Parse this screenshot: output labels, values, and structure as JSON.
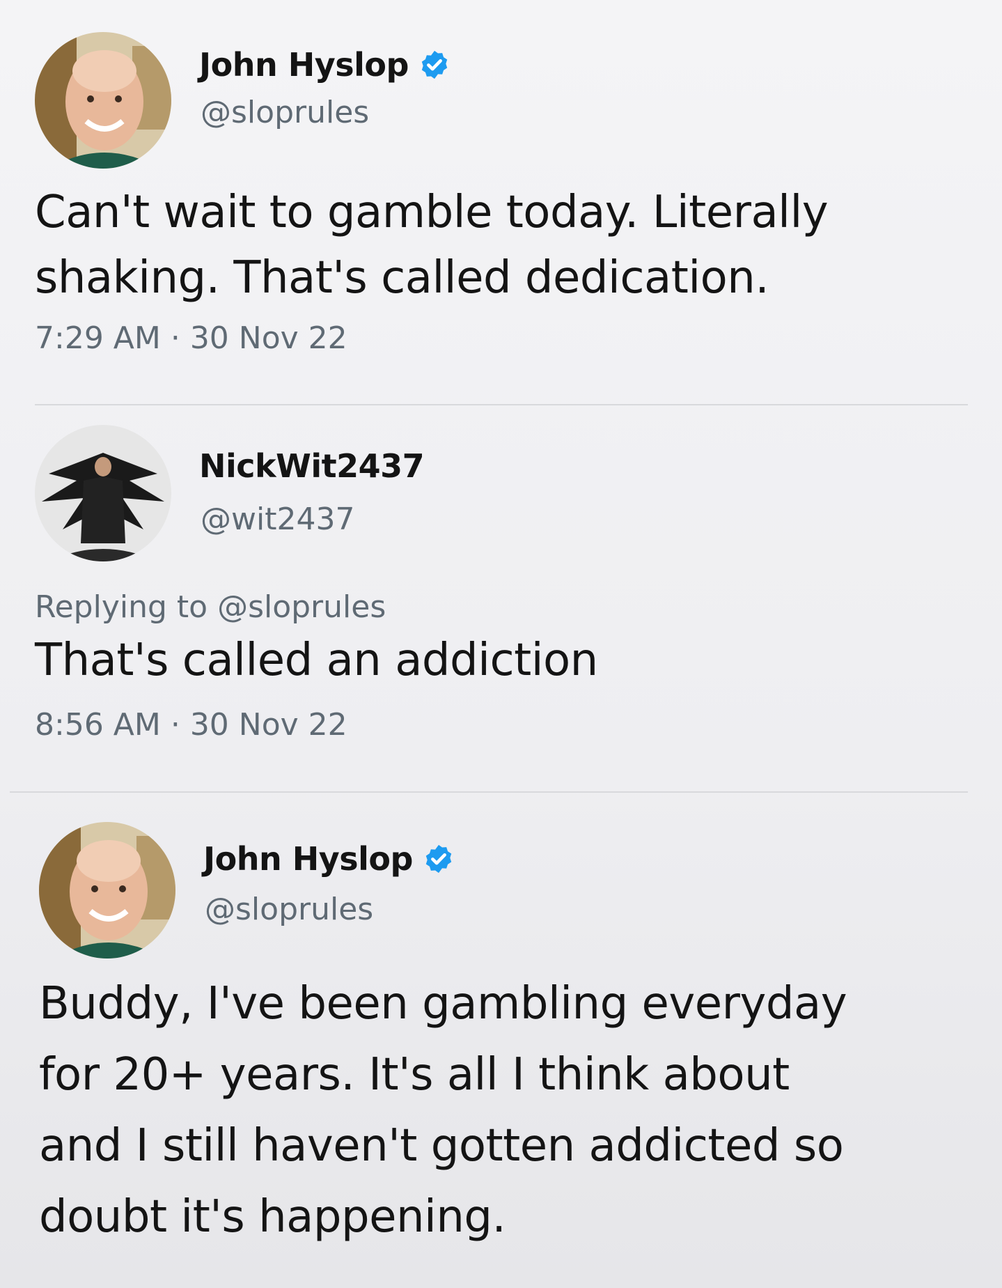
{
  "tweets": [
    {
      "display_name": "John Hyslop",
      "verified": true,
      "handle": "@sloprules",
      "text_lines": [
        "Can't wait to gamble today. Literally",
        "shaking. That's called dedication."
      ],
      "timestamp": "7:29 AM · 30 Nov 22"
    },
    {
      "display_name": "NickWit2437",
      "verified": false,
      "handle": "@wit2437",
      "replying_label": "Replying to",
      "replying_handle": "@sloprules",
      "text_lines": [
        "That's called an addiction"
      ],
      "timestamp": "8:56 AM · 30 Nov 22"
    },
    {
      "display_name": "John Hyslop",
      "verified": true,
      "handle": "@sloprules",
      "text_lines": [
        "Buddy, I've been gambling everyday",
        "for 20+ years. It's all I think about",
        "and I still haven't gotten addicted so",
        "doubt it's happening."
      ]
    }
  ],
  "colors": {
    "verified_badge": "#1d9bf0",
    "secondary_text": "#5f6a74",
    "primary_text": "#141414"
  },
  "icons": {
    "verified": "verified-badge-icon"
  }
}
